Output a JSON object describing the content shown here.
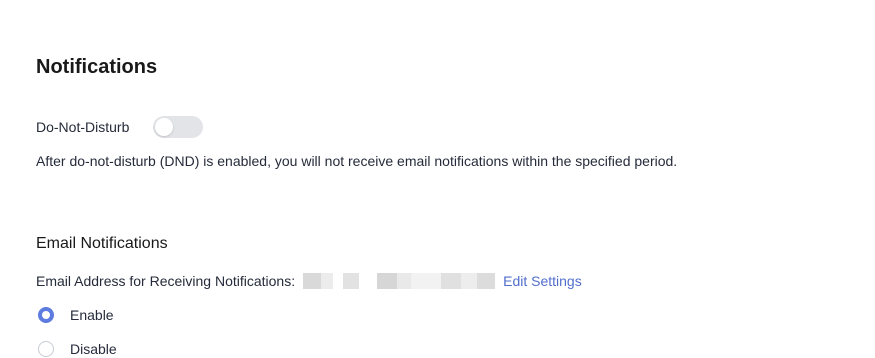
{
  "page": {
    "title": "Notifications"
  },
  "dnd": {
    "label": "Do-Not-Disturb",
    "enabled": false,
    "description": "After do-not-disturb (DND) is enabled, you will not receive email notifications within the specified period."
  },
  "email": {
    "section_title": "Email Notifications",
    "address_label": "Email Address for Receiving Notifications:",
    "edit_link": "Edit Settings",
    "options": [
      {
        "label": "Enable",
        "selected": true
      },
      {
        "label": "Disable",
        "selected": false
      }
    ]
  },
  "colors": {
    "accent": "#5e7ce0",
    "link": "#526ecc",
    "text": "#252b3a",
    "toggle_off": "#e2e4e8"
  }
}
